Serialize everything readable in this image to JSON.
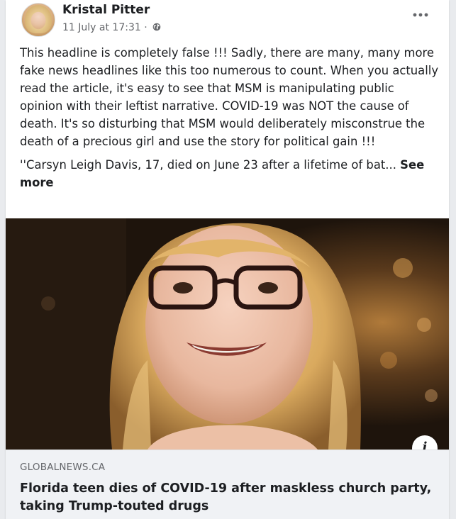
{
  "post": {
    "author": "Kristal Pitter",
    "timestamp": "11 July at 17:31",
    "separator": "·",
    "privacy_icon": "globe-icon",
    "more_icon": "more-options-icon",
    "body_paragraph": "This headline is completely false !!! Sadly, there are many, many more fake news headlines like this too numerous to count. When you actually read the article, it's easy to see that MSM is manipulating public opinion with their leftist narrative. COVID-19 was NOT the cause of death. It's so disturbing that MSM would deliberately misconstrue the death of a precious girl and use the story for political gain !!!",
    "quote_preview": "''Carsyn Leigh Davis, 17, died on June 23 after a lifetime of bat...",
    "see_more_label": "See more"
  },
  "link": {
    "info_icon": "info-icon",
    "info_label": "i",
    "domain": "GLOBALNEWS.CA",
    "title": "Florida teen dies of COVID-19 after maskless church party, taking Trump-touted drugs"
  },
  "colors": {
    "text_primary": "#1c1e21",
    "text_secondary": "#65676b",
    "link_footer_bg": "#f0f2f5",
    "page_bg": "#e9ebee"
  }
}
